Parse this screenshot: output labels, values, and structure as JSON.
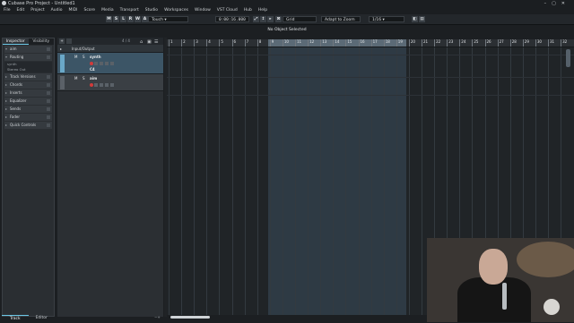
{
  "window": {
    "title": "Cubase Pro Project - Untitled1"
  },
  "menu": [
    "File",
    "Edit",
    "Project",
    "Audio",
    "MIDI",
    "Score",
    "Media",
    "Transport",
    "Studio",
    "Workspaces",
    "Window",
    "VST Cloud",
    "Hub",
    "Help"
  ],
  "toolbar": {
    "buttons": [
      "M",
      "S",
      "L",
      "R",
      "W",
      "A"
    ],
    "automation_mode": "Touch",
    "time_display": "0:00:16.000",
    "snap_type": "Grid",
    "zoom_mode": "Adapt to Zoom",
    "quantize": "1/16"
  },
  "status": "No Object Selected",
  "inspector": {
    "tabs": [
      "Inspector",
      "Visibility"
    ],
    "track_name": "aim",
    "routing_label": "Routing",
    "routing_in": "synth",
    "routing_out": "Stereo Out",
    "sections": [
      "Track Versions",
      "Chords",
      "Inserts",
      "Equalizer",
      "Sends",
      "Fader",
      "Quick Controls"
    ]
  },
  "bottom_tabs": [
    "Track",
    "Editor"
  ],
  "tracklist": {
    "count": "4 / 4",
    "folder": "Input/Output",
    "tracks": [
      {
        "name": "synth",
        "sub": "C4",
        "mute": "M",
        "solo": "S"
      },
      {
        "name": "aim",
        "mute": "M",
        "solo": "S"
      }
    ]
  },
  "ruler": {
    "bars": [
      "1",
      "2",
      "3",
      "4",
      "5",
      "6",
      "7",
      "8",
      "9",
      "10",
      "11",
      "12",
      "13",
      "14",
      "15",
      "16",
      "17",
      "18",
      "19",
      "20",
      "21",
      "22",
      "23",
      "24",
      "25",
      "26",
      "27",
      "28",
      "29",
      "30",
      "31",
      "32"
    ]
  }
}
